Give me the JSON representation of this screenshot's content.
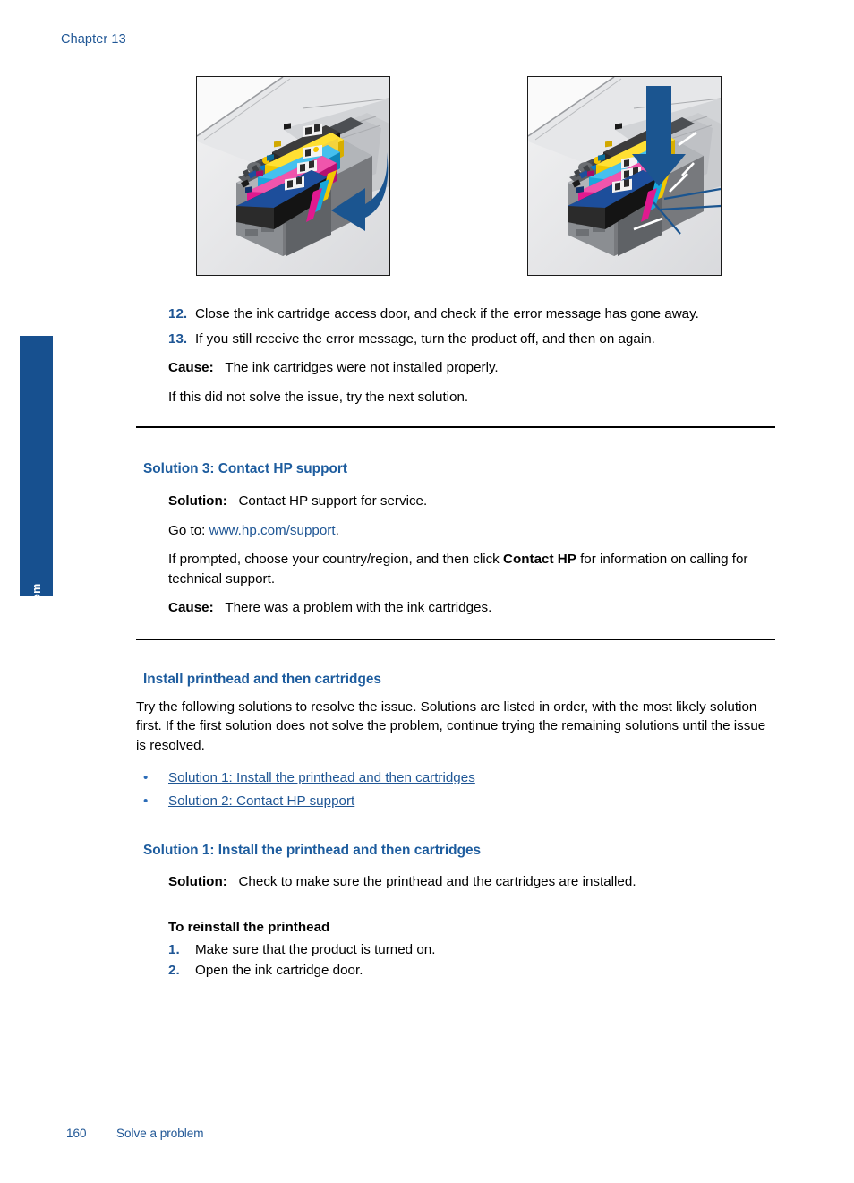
{
  "header": {
    "chapter": "Chapter 13"
  },
  "side_tab": {
    "label": "Solve a problem",
    "color": "#17508f"
  },
  "figures": {
    "left": {
      "name": "ink-cartridge-carriage-close-latch",
      "caption": "Printer carriage with four color ink cartridges and a curved blue arrow pointing left toward the cartridges"
    },
    "right": {
      "name": "ink-cartridge-carriage-press-down",
      "caption": "Printer carriage with four color ink cartridges and a straight blue arrow pressing down, plus callout leader lines"
    }
  },
  "steps_continued": [
    {
      "num": "12.",
      "text": "Close the ink cartridge access door, and check if the error message has gone away."
    },
    {
      "num": "13.",
      "text": "If you still receive the error message, turn the product off, and then on again."
    }
  ],
  "cause_1": {
    "label": "Cause:",
    "text": "The ink cartridges were not installed properly."
  },
  "next_solution_note": "If this did not solve the issue, try the next solution.",
  "solution3": {
    "heading": "Solution 3: Contact HP support",
    "solution_label": "Solution:",
    "solution_text": "Contact HP support for service.",
    "goto_prefix": "Go to:",
    "goto_link": "www.hp.com/support",
    "goto_suffix": ".",
    "prompted_part1": "If prompted, choose your country/region, and then click ",
    "prompted_bold": "Contact HP",
    "prompted_part2": " for information on calling for technical support.",
    "cause_label": "Cause:",
    "cause_text": "There was a problem with the ink cartridges."
  },
  "install_section": {
    "heading": "Install printhead and then cartridges",
    "intro": "Try the following solutions to resolve the issue. Solutions are listed in order, with the most likely solution first. If the first solution does not solve the problem, continue trying the remaining solutions until the issue is resolved.",
    "links": [
      {
        "bullet": "•",
        "label": "Solution 1: Install the printhead and then cartridges"
      },
      {
        "bullet": "•",
        "label": "Solution 2: Contact HP support"
      }
    ]
  },
  "solution1": {
    "heading": "Solution 1: Install the printhead and then cartridges",
    "solution_label": "Solution:",
    "solution_text": "Check to make sure the printhead and the cartridges are installed.",
    "procedure_title": "To reinstall the printhead",
    "steps": [
      {
        "num": "1.",
        "text": "Make sure that the product is turned on."
      },
      {
        "num": "2.",
        "text": "Open the ink cartridge door."
      }
    ]
  },
  "footer": {
    "page": "160",
    "section": "Solve a problem"
  },
  "colors": {
    "heading_blue": "#1d5c9e",
    "link_blue": "#1f5695",
    "tab_blue": "#17508f",
    "arrow_blue": "#1b5590"
  }
}
